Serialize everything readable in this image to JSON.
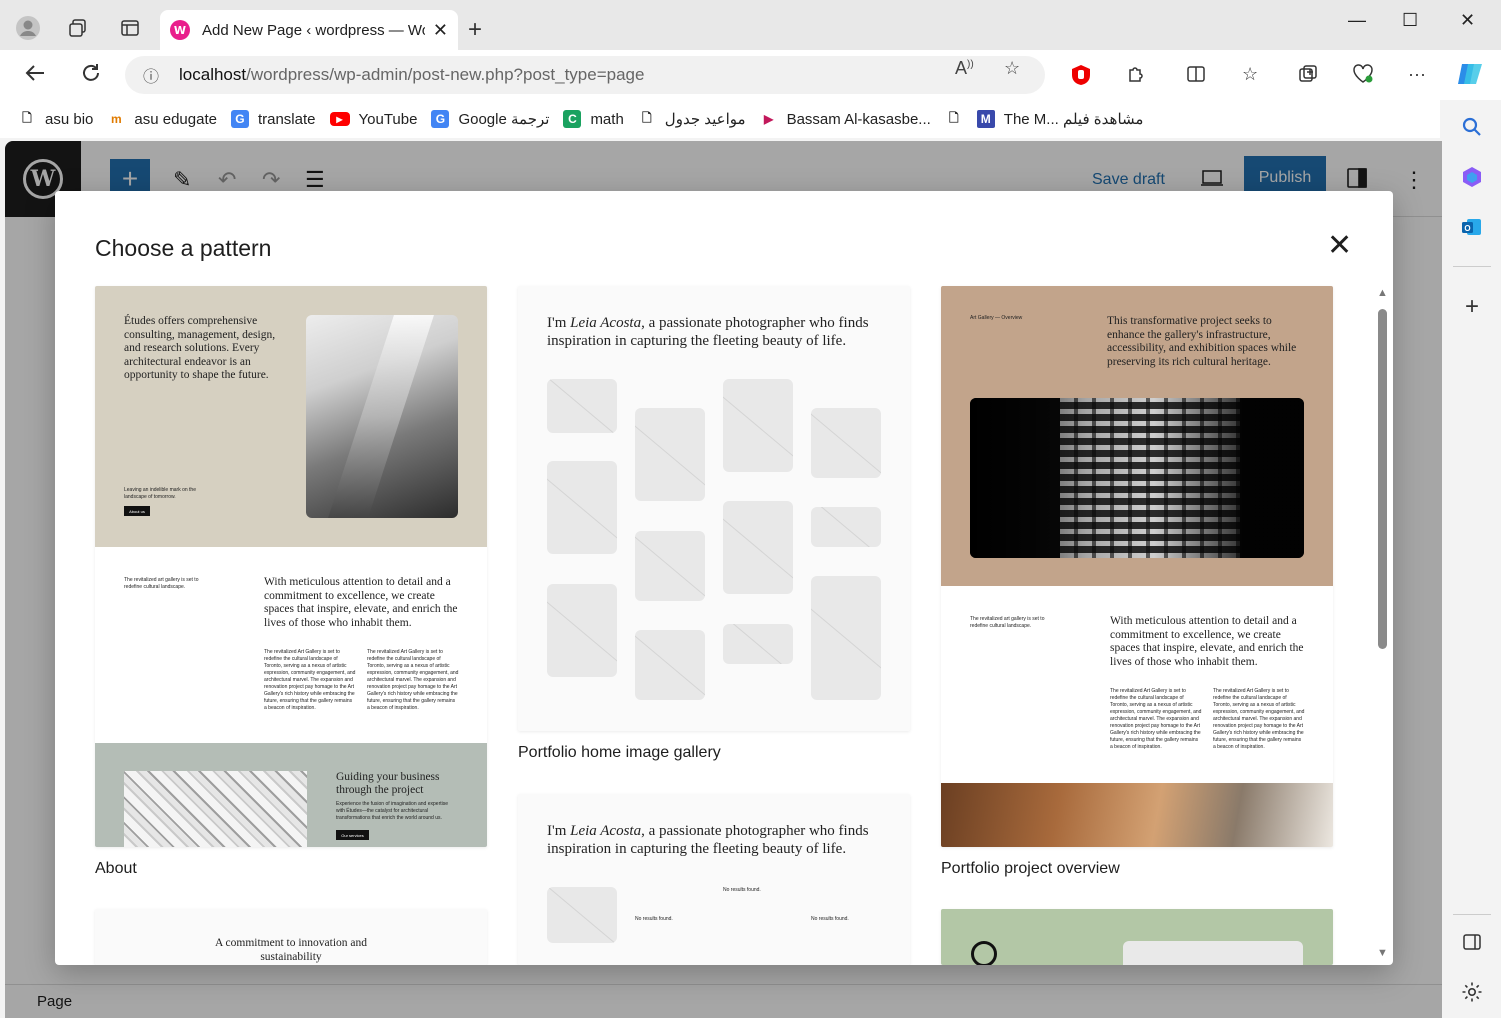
{
  "browser": {
    "tab_title": "Add New Page ‹ wordpress — WordPress",
    "tab_favicon": "W",
    "url_host": "localhost",
    "url_path": "/wordpress/wp-admin/post-new.php?post_type=page",
    "bookmarks": [
      {
        "label": "asu bio",
        "icon": "page-icon"
      },
      {
        "label": "asu edugate",
        "icon": "m-logo-icon"
      },
      {
        "label": "translate",
        "icon": "google-translate-icon"
      },
      {
        "label": "YouTube",
        "icon": "youtube-icon"
      },
      {
        "label": "Google ترجمة",
        "icon": "google-translate-icon"
      },
      {
        "label": "math",
        "icon": "c-logo-icon"
      },
      {
        "label": "مواعيد جدول",
        "icon": "page-icon"
      },
      {
        "label": "Bassam Al-kasasbe...",
        "icon": "play-icon"
      },
      {
        "label": "",
        "icon": "page-icon"
      },
      {
        "label": "The M... مشاهدة فيلم",
        "icon": "m-logo-icon"
      }
    ]
  },
  "editor": {
    "save_draft": "Save draft",
    "publish": "Publish",
    "status_label": "Page"
  },
  "modal": {
    "title": "Choose a pattern",
    "patterns": {
      "about": {
        "label": "About",
        "intro": "Études offers comprehensive consulting, management, design, and research solutions. Every architectural endeavor is an opportunity to shape the future.",
        "tagline": "Leaving an indelible mark on the landscape of tomorrow.",
        "button": "About us",
        "small_note": "The revitalized art gallery is set to redefine cultural landscape.",
        "statement": "With meticulous attention to detail and a commitment to excellence, we create spaces that inspire, elevate, and enrich the lives of those who inhabit them.",
        "body": "The revitalized Art Gallery is set to redefine the cultural landscape of Toronto, serving as a nexus of artistic expression, community engagement, and architectural marvel. The expansion and renovation project pay homage to the Art Gallery's rich history while embracing the future, ensuring that the gallery remains a beacon of inspiration.",
        "guide_title": "Guiding your business through the project",
        "guide_body": "Experience the fusion of imagination and expertise with Études—the catalyst for architectural transformations that enrich the world around us.",
        "guide_button": "Our services"
      },
      "gallery_home": {
        "label": "Portfolio home image gallery",
        "heading_pre": "I'm ",
        "heading_name": "Leia Acosta",
        "heading_post": ", a passionate photographer who finds inspiration in capturing the fleeting beauty of life."
      },
      "gallery_second": {
        "heading_pre": "I'm ",
        "heading_name": "Leia Acosta",
        "heading_post": ", a passionate photographer who finds inspiration in capturing the fleeting beauty of life.",
        "no_results": "No results found."
      },
      "project": {
        "label": "Portfolio project overview",
        "kicker": "Art Gallery — Overview",
        "intro": "This transformative project seeks to enhance the gallery's infrastructure, accessibility, and exhibition spaces while preserving its rich cultural heritage.",
        "small_note": "The revitalized art gallery is set to redefine cultural landscape.",
        "statement": "With meticulous attention to detail and a commitment to excellence, we create spaces that inspire, elevate, and enrich the lives of those who inhabit them.",
        "body": "The revitalized Art Gallery is set to redefine the cultural landscape of Toronto, serving as a nexus of artistic expression, community engagement, and architectural marvel. The expansion and renovation project pay homage to the Art Gallery's rich history while embracing the future, ensuring that the gallery remains a beacon of inspiration."
      },
      "commitment": {
        "text": "A commitment to innovation and sustainability"
      }
    }
  },
  "colors": {
    "wp_blue": "#2271b1",
    "about_beige": "#d6d0c1",
    "about_sage": "#b4bdb6",
    "project_tan": "#c2a48b",
    "green_card": "#b3c7a6"
  }
}
